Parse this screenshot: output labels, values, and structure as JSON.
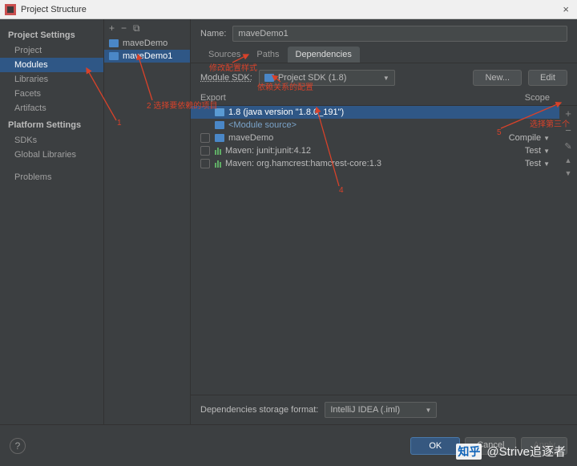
{
  "window": {
    "title": "Project Structure",
    "close": "×"
  },
  "sidebar": {
    "groups": [
      {
        "heading": "Project Settings",
        "items": [
          "Project",
          "Modules",
          "Libraries",
          "Facets",
          "Artifacts"
        ],
        "selected": 1
      },
      {
        "heading": "Platform Settings",
        "items": [
          "SDKs",
          "Global Libraries"
        ],
        "selected": -1
      },
      {
        "heading": "",
        "items": [
          "Problems"
        ],
        "selected": -1
      }
    ]
  },
  "modules": {
    "toolbar": {
      "add": "+",
      "remove": "−",
      "copy": "⧉"
    },
    "items": [
      "maveDemo",
      "maveDemo1"
    ],
    "selected": 1
  },
  "main": {
    "name_label": "Name:",
    "name_value": "maveDemo1",
    "tabs": [
      "Sources",
      "Paths",
      "Dependencies"
    ],
    "selected_tab": 2,
    "sdk_label": "Module SDK:",
    "sdk_value": "Project SDK (1.8)",
    "new_btn": "New...",
    "edit_btn": "Edit",
    "cols": {
      "export": "Export",
      "scope": "Scope"
    },
    "deps": [
      {
        "label": "1.8 (java version \"1.8.0_191\")",
        "icon": "jdk",
        "scope": "",
        "check": false,
        "selected": true
      },
      {
        "label": "<Module source>",
        "icon": "src",
        "scope": "",
        "check": false
      },
      {
        "label": "maveDemo",
        "icon": "module",
        "scope": "Compile",
        "check": false
      },
      {
        "label": "Maven: junit:junit:4.12",
        "icon": "maven",
        "scope": "Test",
        "check": false
      },
      {
        "label": "Maven: org.hamcrest:hamcrest-core:1.3",
        "icon": "maven",
        "scope": "Test",
        "check": false
      }
    ],
    "side_btns": {
      "add": "+",
      "remove": "−",
      "edit": "✎",
      "up": "▲",
      "down": "▼"
    },
    "storage_label": "Dependencies storage format:",
    "storage_value": "IntelliJ IDEA (.iml)"
  },
  "footer": {
    "help": "?",
    "ok": "OK",
    "cancel": "Cancel",
    "apply": "Apply"
  },
  "annotations": {
    "a1": "1",
    "a2": "2    选择要依赖的项目",
    "a3": "修改配置样式",
    "a4": "依赖关系的配置",
    "a5": "4",
    "a6": "5",
    "a7": "选择第三个"
  },
  "watermark": "@Strive追逐者",
  "zhihu": "知乎"
}
